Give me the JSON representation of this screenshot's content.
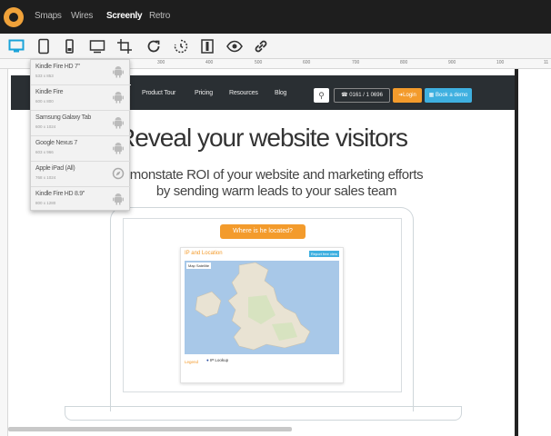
{
  "topnav": {
    "items": [
      {
        "label": "Smaps",
        "active": false
      },
      {
        "label": "Wires",
        "active": false
      },
      {
        "label": "Screenly",
        "active": true
      },
      {
        "label": "Retro",
        "active": false
      }
    ]
  },
  "toolbar": {
    "buttons": [
      {
        "icon": "desktop-icon",
        "active": true
      },
      {
        "icon": "tablet-icon",
        "active": false
      },
      {
        "icon": "mobile-icon",
        "active": false
      },
      {
        "icon": "custom-size-icon",
        "active": false
      },
      {
        "icon": "crop-icon",
        "active": false
      },
      {
        "icon": "refresh-icon",
        "active": false
      },
      {
        "icon": "rotate-icon",
        "active": false
      },
      {
        "icon": "grid-icon",
        "active": false
      },
      {
        "icon": "eye-icon",
        "active": false
      },
      {
        "icon": "link-icon",
        "active": false
      }
    ]
  },
  "ruler": {
    "ticks": [
      "300",
      "400",
      "500",
      "600",
      "700",
      "800",
      "900",
      "100",
      "11"
    ]
  },
  "device_menu": {
    "items": [
      {
        "name": "Kindle Fire HD 7\"",
        "size": "533 x 853",
        "icon": "android-icon"
      },
      {
        "name": "Kindle Fire",
        "size": "600 x 800",
        "icon": "android-icon"
      },
      {
        "name": "Samsung Galaxy Tab",
        "size": "600 x 1024",
        "icon": "android-icon"
      },
      {
        "name": "Google Nexus 7",
        "size": "603 x 966",
        "icon": "android-icon"
      },
      {
        "name": "Apple iPad (All)",
        "size": "768 x 1024",
        "icon": "safari-icon"
      },
      {
        "name": "Kindle Fire HD 8.9\"",
        "size": "800 x 1280",
        "icon": "android-icon"
      }
    ]
  },
  "site": {
    "nav": {
      "links": [
        "Product Tour",
        "Pricing",
        "Resources",
        "Blog"
      ],
      "phone": "0161 / 1 0696",
      "login": "Login",
      "demo": "Book a demo"
    },
    "hero_title": "Reveal your website visitors",
    "hero_sub_line1": "monstate ROI of your website and marketing efforts",
    "hero_sub_line2": "by sending warm leads to your sales team",
    "locate_button": "Where is he located?",
    "ip_card": {
      "title": "IP and Location",
      "badge": "Report free view",
      "map_tabs": "Map  Satellite",
      "legend": "Legend",
      "legend_item": "IP Lookup"
    }
  },
  "colors": {
    "accent_orange": "#f39b2c",
    "accent_blue": "#3fb0e0",
    "active_blue": "#1aa3d9",
    "topbar": "#1e1e1e"
  }
}
